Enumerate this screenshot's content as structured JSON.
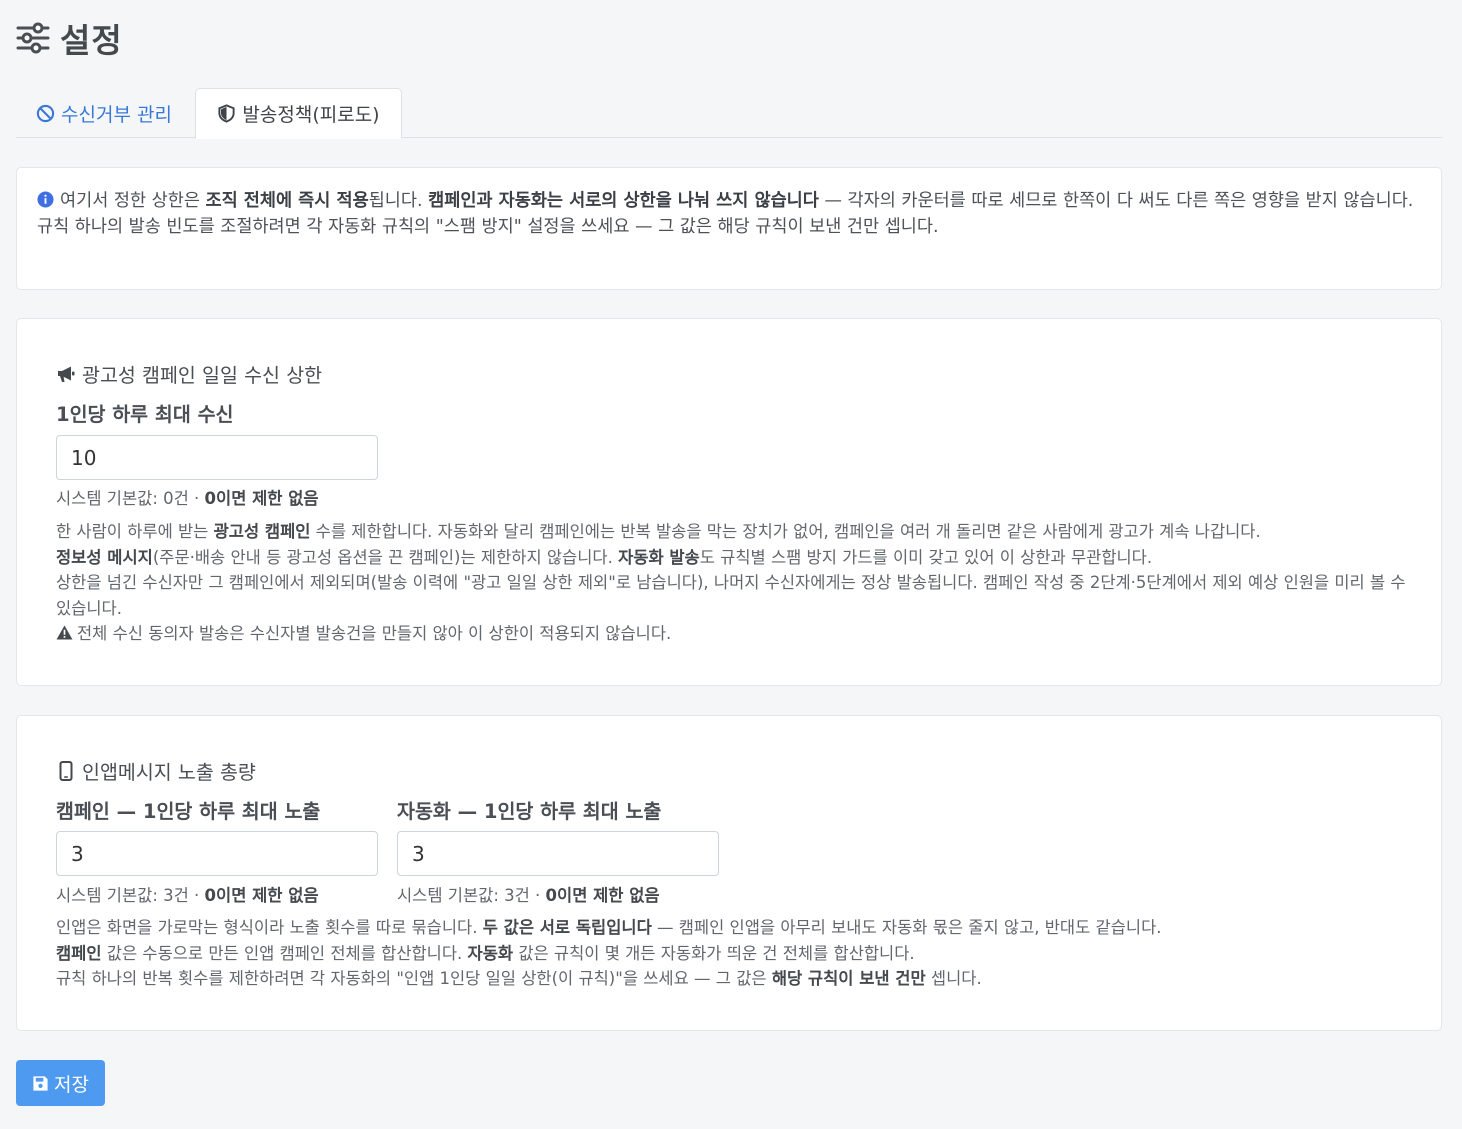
{
  "page": {
    "title": "설정"
  },
  "tabs": [
    {
      "label": "수신거부 관리",
      "icon": "ban-icon",
      "active": false
    },
    {
      "label": "발송정책(피로도)",
      "icon": "shield-icon",
      "active": true
    }
  ],
  "info": {
    "line1": [
      {
        "t": "여기서 정한 상한은 ",
        "b": false
      },
      {
        "t": "조직 전체에 즉시 적용",
        "b": true
      },
      {
        "t": "됩니다. ",
        "b": false
      },
      {
        "t": "캠페인과 자동화는 서로의 상한을 나눠 쓰지 않습니다",
        "b": true
      },
      {
        "t": " — 각자의 카운터를 따로 세므로 한쪽이 다 써도 다른 쪽은 영향을 받지 않습니다.",
        "b": false
      }
    ],
    "line2": "규칙 하나의 발송 빈도를 조절하려면 각 자동화 규칙의 \"스팸 방지\" 설정을 쓰세요 — 그 값은 해당 규칙이 보낸 건만 셉니다."
  },
  "ad_cap": {
    "title": "광고성 캠페인 일일 수신 상한",
    "field_label": "1인당 하루 최대 수신",
    "value": "10",
    "hint_plain": "시스템 기본값: 0건 · ",
    "hint_bold": "0이면 제한 없음",
    "desc": [
      [
        {
          "t": "한 사람이 하루에 받는 ",
          "b": false
        },
        {
          "t": "광고성 캠페인",
          "b": true
        },
        {
          "t": " 수를 제한합니다. 자동화와 달리 캠페인에는 반복 발송을 막는 장치가 없어, 캠페인을 여러 개 돌리면 같은 사람에게 광고가 계속 나갑니다.",
          "b": false
        }
      ],
      [
        {
          "t": "정보성 메시지",
          "b": true
        },
        {
          "t": "(주문·배송 안내 등 광고성 옵션을 끈 캠페인)는 제한하지 않습니다. ",
          "b": false
        },
        {
          "t": "자동화 발송",
          "b": true
        },
        {
          "t": "도 규칙별 스팸 방지 가드를 이미 갖고 있어 이 상한과 무관합니다.",
          "b": false
        }
      ],
      [
        {
          "t": "상한을 넘긴 수신자만 그 캠페인에서 제외되며(발송 이력에 \"광고 일일 상한 제외\"로 남습니다), 나머지 수신자에게는 정상 발송됩니다. 캠페인 작성 중 2단계·5단계에서 제외 예상 인원을 미리 볼 수 있습니다.",
          "b": false
        }
      ]
    ],
    "warning": "전체 수신 동의자 발송은 수신자별 발송건을 만들지 않아 이 상한이 적용되지 않습니다."
  },
  "inapp_cap": {
    "title": "인앱메시지 노출 총량",
    "campaign": {
      "label": "캠페인 — 1인당 하루 최대 노출",
      "value": "3",
      "hint_plain": "시스템 기본값: 3건 · ",
      "hint_bold": "0이면 제한 없음"
    },
    "automation": {
      "label": "자동화 — 1인당 하루 최대 노출",
      "value": "3",
      "hint_plain": "시스템 기본값: 3건 · ",
      "hint_bold": "0이면 제한 없음"
    },
    "desc": [
      [
        {
          "t": "인앱은 화면을 가로막는 형식이라 노출 횟수를 따로 묶습니다. ",
          "b": false
        },
        {
          "t": "두 값은 서로 독립입니다",
          "b": true
        },
        {
          "t": " — 캠페인 인앱을 아무리 보내도 자동화 몫은 줄지 않고, 반대도 같습니다.",
          "b": false
        }
      ],
      [
        {
          "t": "캠페인",
          "b": true
        },
        {
          "t": " 값은 수동으로 만든 인앱 캠페인 전체를 합산합니다. ",
          "b": false
        },
        {
          "t": "자동화",
          "b": true
        },
        {
          "t": " 값은 규칙이 몇 개든 자동화가 띄운 건 전체를 합산합니다.",
          "b": false
        }
      ],
      [
        {
          "t": "규칙 하나의 반복 횟수를 제한하려면 각 자동화의 \"인앱 1인당 일일 상한(이 규칙)\"을 쓰세요 — 그 값은 ",
          "b": false
        },
        {
          "t": "해당 규칙이 보낸 건만",
          "b": true
        },
        {
          "t": " 셉니다.",
          "b": false
        }
      ]
    ]
  },
  "save_button": {
    "label": "저장"
  },
  "colors": {
    "link": "#3a78d7",
    "primary": "#4e9af1",
    "info_icon": "#3f6fe0"
  }
}
